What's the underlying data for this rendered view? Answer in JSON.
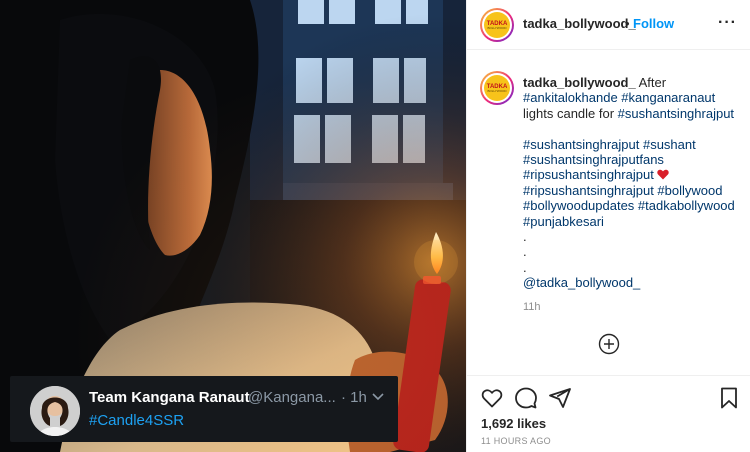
{
  "media": {
    "tweet": {
      "name": "Team Kangana Ranaut",
      "handle": "@Kangana...",
      "time": "· 1h",
      "hashtag": "#Candle4SSR",
      "colors": {
        "background": "#15181c",
        "hashtag": "#1da1f2",
        "muted": "#8b98a5"
      }
    }
  },
  "post": {
    "header": {
      "username": "tadka_bollywood_",
      "separator": "•",
      "follow_label": "Follow",
      "more_label": "···",
      "logo": {
        "word": "TADKA",
        "sub": "BOLLYWOOD"
      }
    },
    "caption": {
      "username": "tadka_bollywood_",
      "text_first": "After",
      "tags_line1": "#ankitalokhande #kanganaranaut",
      "text_line2": "lights candle for ",
      "tag_line2": "#sushantsinghrajput",
      "tags_block": [
        "#sushantsinghrajput #sushant",
        "#sushantsinghrajputfans",
        "#ripsushantsinghrajput",
        "#ripsushantsinghrajput #bollywood",
        "#bollywoodupdates #tadkabollywood",
        "#punjabkesari"
      ],
      "dots": [
        ".",
        ".",
        "."
      ],
      "mention": "@tadka_bollywood_"
    },
    "comment_time": "11h",
    "likes": "1,692 likes",
    "posted": "11 HOURS AGO",
    "icons": [
      "heart-icon",
      "comment-icon",
      "share-icon",
      "bookmark-icon",
      "add-circle-icon"
    ],
    "colors": {
      "link": "#00376b",
      "follow": "#0095f6",
      "muted": "#8e8e8e",
      "text": "#262626"
    }
  }
}
